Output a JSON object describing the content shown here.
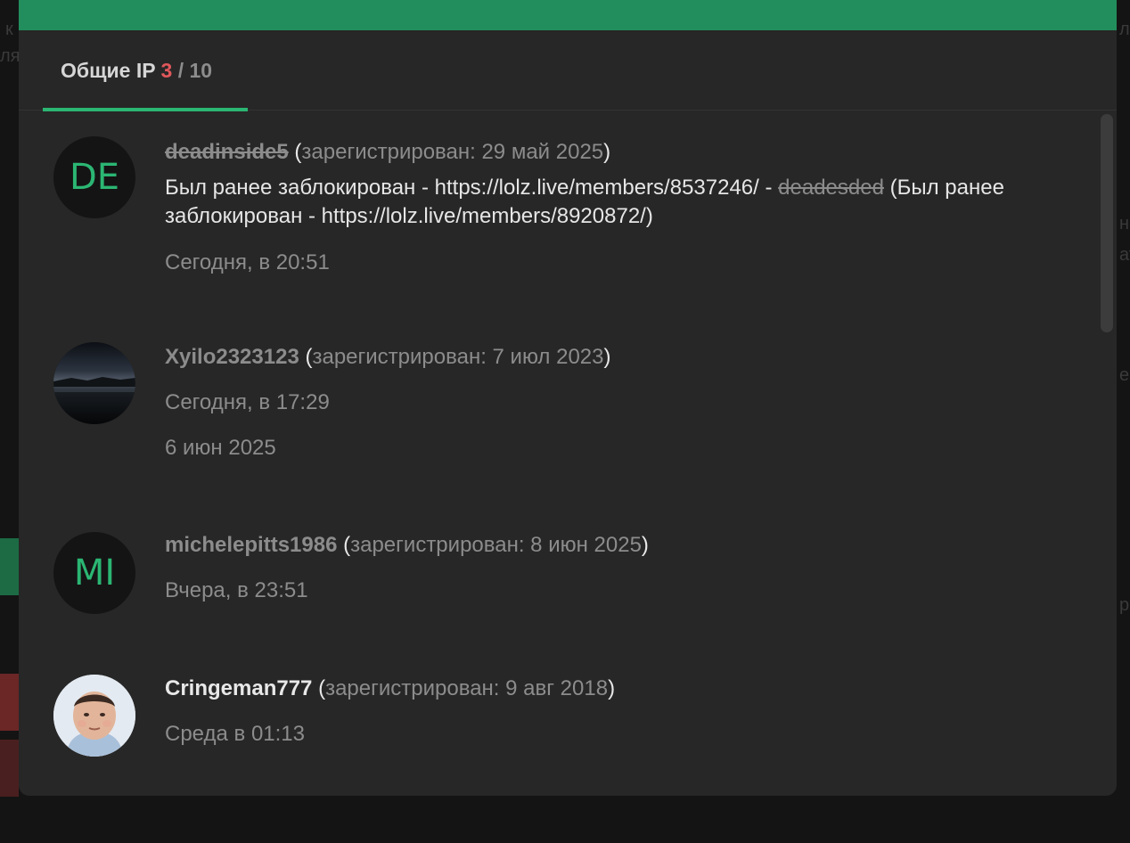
{
  "tab": {
    "label": "Общие IP",
    "count": "3",
    "separator": "/",
    "total": "10"
  },
  "items": [
    {
      "avatar": {
        "type": "initials",
        "text": "DE"
      },
      "username": "deadinside5",
      "username_state": "banned",
      "registered": "зарегистрирован: 29 май 2025",
      "note": {
        "part1": "Был ранее заблокирован - https://lolz.live/members/8537246/ -",
        "alias": "deadesded",
        "part2": "(Был ранее заблокирован - https://lolz.live/members/8920872/)"
      },
      "dates": [
        "Сегодня, в 20:51"
      ]
    },
    {
      "avatar": {
        "type": "image",
        "subject": "night-lake-photo"
      },
      "username": "Xyilo2323123",
      "username_state": "normal",
      "registered": "зарегистрирован: 7 июл 2023",
      "dates": [
        "Сегодня, в 17:29",
        "6 июн 2025"
      ]
    },
    {
      "avatar": {
        "type": "initials",
        "text": "MI"
      },
      "username": "michelepitts1986",
      "username_state": "normal",
      "registered": "зарегистрирован: 8 июн 2025",
      "dates": [
        "Вчера, в 23:51"
      ]
    },
    {
      "avatar": {
        "type": "image",
        "subject": "person-photo"
      },
      "username": "Cringeman777",
      "username_state": "active",
      "registered": "зарегистрирован: 9 авг 2018",
      "dates": [
        "Среда в 01:13"
      ]
    }
  ],
  "colors": {
    "topbar": "#228e5d",
    "accent": "#2bb673",
    "count_red": "#e0575b",
    "modal_bg": "#272727"
  }
}
